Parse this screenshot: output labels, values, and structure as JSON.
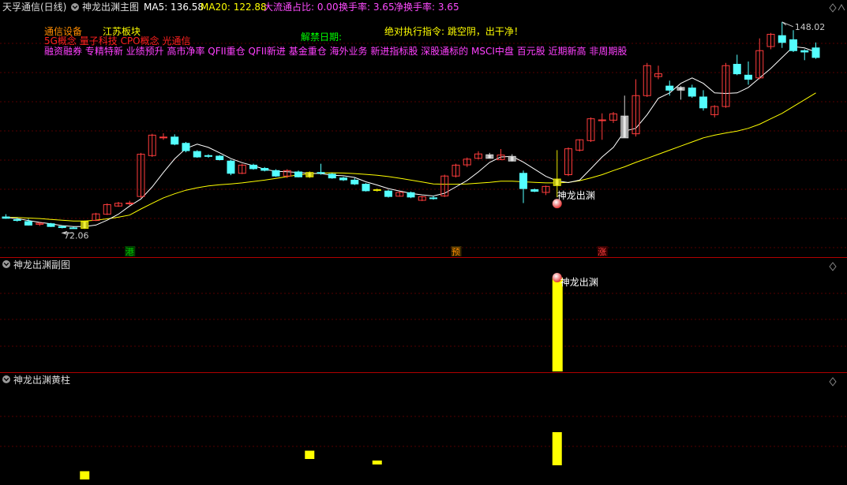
{
  "header": {
    "stock_name": "天孚通信(日线)",
    "indicator_name": "神龙出渊主图",
    "ma5_label": "MA5: 136.58",
    "ma20_label": "MA20: 122.88",
    "flow_label": "大流通占比: 0.00",
    "turnover_label": "换手率: 3.65",
    "net_turnover_label": "净换手率: 3.65"
  },
  "info": {
    "industry": "通信设备",
    "region": "江苏板块",
    "unlock_label": "解禁日期:",
    "instruction": "绝对执行指令: 跳空阴，出干净！",
    "concepts_line1": "5G概念 量子科技 CPO概念 光通信",
    "concepts_line2": "融资融券 专精特新 业绩预升 高市净率 QFII重仓 QFII新进 基金重仓 海外业务 新进指标股 深股通标的 MSCI中盘 百元股 近期新高 非周期股"
  },
  "colors": {
    "background": "#000000",
    "up": "#ff3c3c",
    "down": "#54ffff",
    "ma5": "#ffffff",
    "ma20": "#ffff00",
    "yellow_bar": "#ffff00",
    "divider": "#b00000",
    "grid": "#500000"
  },
  "chart_data": [
    {
      "type": "candlestick",
      "title": "神龙出渊主图",
      "ylim": [
        69,
        150
      ],
      "high_marker": "148.02",
      "low_marker": "72.06",
      "signal_label": "神龙出渊",
      "event_markers": [
        {
          "index": 11,
          "label": "港"
        },
        {
          "index": 40,
          "label": "预"
        },
        {
          "index": 53,
          "label": "涨"
        }
      ],
      "candles": [
        {
          "o": 76.5,
          "h": 77.5,
          "l": 75.8,
          "c": 76.0
        },
        {
          "o": 75.5,
          "h": 76.2,
          "l": 74.8,
          "c": 75.2
        },
        {
          "o": 74.8,
          "h": 75.8,
          "l": 73.3,
          "c": 73.5
        },
        {
          "o": 73.8,
          "h": 74.5,
          "l": 73.2,
          "c": 74.2
        },
        {
          "o": 74.0,
          "h": 74.3,
          "l": 72.8,
          "c": 73.0
        },
        {
          "o": 73.0,
          "h": 73.4,
          "l": 72.3,
          "c": 72.6
        },
        {
          "o": 72.5,
          "h": 72.9,
          "l": 72.06,
          "c": 72.4
        },
        {
          "o": 72.3,
          "h": 75.2,
          "l": 72.1,
          "c": 74.8,
          "signal": true
        },
        {
          "o": 75.2,
          "h": 78.0,
          "l": 75.0,
          "c": 77.6
        },
        {
          "o": 77.5,
          "h": 81.5,
          "l": 77.2,
          "c": 81.0
        },
        {
          "o": 80.5,
          "h": 82.0,
          "l": 80.2,
          "c": 81.5
        },
        {
          "o": 81.5,
          "h": 82.4,
          "l": 80.8,
          "c": 81.6
        },
        {
          "o": 84.0,
          "h": 100.0,
          "l": 83.5,
          "c": 99.5
        },
        {
          "o": 99.0,
          "h": 107.0,
          "l": 98.5,
          "c": 106.5
        },
        {
          "o": 105.5,
          "h": 107.2,
          "l": 104.8,
          "c": 105.8
        },
        {
          "o": 105.8,
          "h": 106.8,
          "l": 102.8,
          "c": 103.2
        },
        {
          "o": 103.5,
          "h": 104.0,
          "l": 100.2,
          "c": 100.8
        },
        {
          "o": 100.5,
          "h": 101.0,
          "l": 98.2,
          "c": 98.5
        },
        {
          "o": 99.0,
          "h": 99.5,
          "l": 98.2,
          "c": 98.8
        },
        {
          "o": 98.8,
          "h": 99.2,
          "l": 97.2,
          "c": 97.5
        },
        {
          "o": 97.0,
          "h": 97.5,
          "l": 91.8,
          "c": 92.5
        },
        {
          "o": 92.5,
          "h": 96.0,
          "l": 92.2,
          "c": 95.5
        },
        {
          "o": 95.5,
          "h": 96.0,
          "l": 93.8,
          "c": 94.2
        },
        {
          "o": 94.3,
          "h": 94.8,
          "l": 93.2,
          "c": 93.6
        },
        {
          "o": 93.5,
          "h": 94.0,
          "l": 91.2,
          "c": 91.5
        },
        {
          "o": 91.5,
          "h": 94.0,
          "l": 90.8,
          "c": 93.5
        },
        {
          "o": 93.0,
          "h": 93.5,
          "l": 91.0,
          "c": 91.2
        },
        {
          "o": 91.2,
          "h": 93.2,
          "l": 90.8,
          "c": 92.8,
          "signal": true
        },
        {
          "o": 92.8,
          "h": 96.0,
          "l": 92.0,
          "c": 92.5
        },
        {
          "o": 92.2,
          "h": 92.6,
          "l": 90.5,
          "c": 90.8
        },
        {
          "o": 90.8,
          "h": 91.2,
          "l": 89.7,
          "c": 90.1
        },
        {
          "o": 90.0,
          "h": 90.8,
          "l": 88.2,
          "c": 88.6
        },
        {
          "o": 88.5,
          "h": 88.9,
          "l": 85.8,
          "c": 86.1
        },
        {
          "o": 86.5,
          "h": 86.9,
          "l": 85.8,
          "c": 86.2,
          "signal": true
        },
        {
          "o": 86.0,
          "h": 86.5,
          "l": 83.6,
          "c": 84.0
        },
        {
          "o": 84.1,
          "h": 85.8,
          "l": 83.9,
          "c": 85.5
        },
        {
          "o": 85.4,
          "h": 85.8,
          "l": 83.4,
          "c": 83.8
        },
        {
          "o": 82.6,
          "h": 84.2,
          "l": 82.3,
          "c": 83.9
        },
        {
          "o": 83.5,
          "h": 84.3,
          "l": 82.8,
          "c": 83.2
        },
        {
          "o": 84.2,
          "h": 92.0,
          "l": 83.8,
          "c": 91.5
        },
        {
          "o": 91.5,
          "h": 96.0,
          "l": 91.0,
          "c": 95.5
        },
        {
          "o": 95.6,
          "h": 98.3,
          "l": 94.8,
          "c": 97.7
        },
        {
          "o": 98.0,
          "h": 100.6,
          "l": 97.6,
          "c": 99.6
        },
        {
          "o": 99.3,
          "h": 100.0,
          "l": 98.4,
          "c": 98.0,
          "gray": true
        },
        {
          "o": 97.5,
          "h": 101.4,
          "l": 97.5,
          "c": 99.2
        },
        {
          "o": 98.7,
          "h": 99.5,
          "l": 96.8,
          "c": 97.0,
          "gray": true
        },
        {
          "o": 92.5,
          "h": 93.5,
          "l": 81.6,
          "c": 86.9
        },
        {
          "o": 86.5,
          "h": 86.9,
          "l": 85.6,
          "c": 85.9
        },
        {
          "o": 85.5,
          "h": 88.0,
          "l": 84.5,
          "c": 87.7
        },
        {
          "o": 88.0,
          "h": 101.0,
          "l": 83.7,
          "c": 90.4,
          "signal": true
        },
        {
          "o": 92.0,
          "h": 102.0,
          "l": 91.5,
          "c": 101.5
        },
        {
          "o": 101.0,
          "h": 105.0,
          "l": 100.5,
          "c": 104.8
        },
        {
          "o": 104.5,
          "h": 113.0,
          "l": 104.0,
          "c": 112.5
        },
        {
          "o": 111.8,
          "h": 114.5,
          "l": 104.8,
          "c": 112.1
        },
        {
          "o": 112.0,
          "h": 115.0,
          "l": 111.0,
          "c": 114.3
        },
        {
          "o": 113.5,
          "h": 121.0,
          "l": 112.0,
          "c": 105.5,
          "gray": true
        },
        {
          "o": 107.0,
          "h": 127.0,
          "l": 106.0,
          "c": 121.0
        },
        {
          "o": 121.0,
          "h": 133.0,
          "l": 120.5,
          "c": 132.0
        },
        {
          "o": 128.0,
          "h": 132.0,
          "l": 127.0,
          "c": 129.0
        },
        {
          "o": 124.5,
          "h": 126.5,
          "l": 121.0,
          "c": 123.0
        },
        {
          "o": 123.0,
          "h": 124.5,
          "l": 119.5,
          "c": 124.0,
          "gray": true
        },
        {
          "o": 123.8,
          "h": 125.0,
          "l": 120.2,
          "c": 120.8
        },
        {
          "o": 120.5,
          "h": 123.0,
          "l": 115.5,
          "c": 116.5
        },
        {
          "o": 114.0,
          "h": 117.5,
          "l": 113.0,
          "c": 117.0
        },
        {
          "o": 117.0,
          "h": 133.0,
          "l": 116.5,
          "c": 132.0
        },
        {
          "o": 132.5,
          "h": 136.0,
          "l": 128.5,
          "c": 129.0
        },
        {
          "o": 128.5,
          "h": 133.5,
          "l": 125.0,
          "c": 127.0
        },
        {
          "o": 127.5,
          "h": 142.0,
          "l": 127.0,
          "c": 137.5
        },
        {
          "o": 139.0,
          "h": 144.0,
          "l": 138.0,
          "c": 143.5
        },
        {
          "o": 143.0,
          "h": 148.02,
          "l": 138.5,
          "c": 140.5
        },
        {
          "o": 141.5,
          "h": 145.0,
          "l": 137.0,
          "c": 137.5
        },
        {
          "o": 137.5,
          "h": 138.0,
          "l": 134.0,
          "c": 137.0
        },
        {
          "o": 138.5,
          "h": 140.5,
          "l": 134.5,
          "c": 135.0
        }
      ],
      "ma5": [
        76.3,
        75.9,
        75.2,
        74.5,
        74.0,
        73.3,
        73.0,
        73.0,
        73.5,
        75.3,
        77.5,
        80.5,
        83.1,
        87.5,
        92.8,
        97.8,
        101.6,
        103.2,
        102.0,
        100.0,
        97.9,
        96.4,
        95.3,
        94.0,
        93.2,
        93.1,
        92.8,
        92.5,
        92.4,
        91.8,
        91.6,
        91.0,
        89.4,
        88.2,
        86.9,
        86.0,
        85.1,
        84.6,
        84.2,
        85.2,
        87.5,
        89.9,
        93.0,
        96.5,
        98.5,
        98.7,
        96.6,
        94.0,
        91.4,
        89.7,
        89.1,
        90.0,
        94.2,
        98.5,
        102.0,
        108.0,
        109.0,
        114.0,
        120.0,
        122.0,
        125.5,
        127.5,
        125.5,
        122.0,
        121.8,
        122.0,
        124.0,
        127.5,
        131.0,
        135.0,
        139.0,
        138.5,
        137.0
      ],
      "ma20": [
        76.3,
        76.3,
        76.1,
        75.9,
        75.6,
        75.3,
        75.0,
        75.0,
        75.3,
        75.8,
        76.4,
        77.2,
        79.4,
        81.5,
        83.5,
        85.0,
        86.3,
        87.2,
        87.9,
        88.3,
        88.6,
        89.0,
        89.5,
        90.0,
        90.6,
        91.3,
        91.9,
        92.3,
        92.6,
        92.7,
        92.6,
        92.4,
        92.1,
        91.8,
        91.3,
        90.7,
        90.0,
        89.3,
        88.6,
        88.5,
        88.5,
        88.6,
        88.9,
        89.2,
        89.6,
        89.6,
        89.4,
        89.2,
        89.0,
        89.0,
        89.2,
        89.8,
        90.8,
        92.0,
        93.5,
        94.9,
        96.5,
        98.0,
        99.5,
        101.0,
        102.5,
        104.0,
        105.5,
        106.5,
        107.3,
        108.0,
        109.0,
        110.5,
        112.5,
        114.5,
        117.0,
        119.5,
        122.0
      ]
    },
    {
      "type": "bar",
      "title": "神龙出渊副图",
      "signal_label": "神龙出渊",
      "ylim": [
        0,
        1
      ],
      "points": [
        {
          "index": 49,
          "value": 1
        }
      ]
    },
    {
      "type": "bar",
      "title": "神龙出渊黄柱",
      "ylim": [
        0,
        1
      ],
      "points": [
        {
          "index": 7,
          "value": 0.25
        },
        {
          "index": 27,
          "value": 0.25
        },
        {
          "index": 33,
          "value": 0.12
        },
        {
          "index": 49,
          "value": 1
        }
      ]
    }
  ]
}
